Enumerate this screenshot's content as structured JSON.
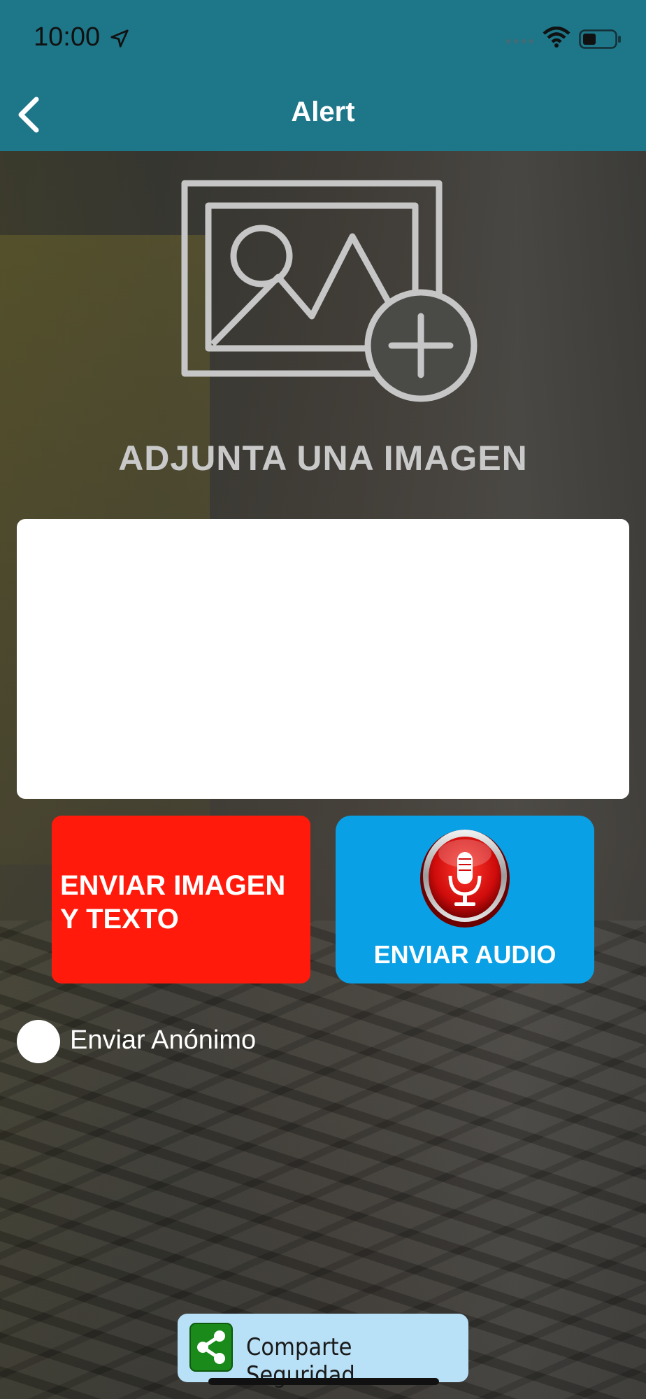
{
  "status_bar": {
    "time": "10:00"
  },
  "header": {
    "title": "Alert"
  },
  "upload": {
    "label": "ADJUNTA UNA IMAGEN"
  },
  "message": {
    "placeholder": ""
  },
  "buttons": {
    "send_image_text_line1": "ENVIAR IMAGEN",
    "send_image_text_line2": "Y TEXTO",
    "send_audio": "ENVIAR AUDIO"
  },
  "anonymous": {
    "label": "Enviar Anónimo",
    "checked": false
  },
  "share": {
    "label": "Comparte Seguridad"
  },
  "colors": {
    "header": "#1e7689",
    "send_image": "#ff1a0c",
    "send_audio": "#09a0e6",
    "share": "#b8e0f6"
  }
}
